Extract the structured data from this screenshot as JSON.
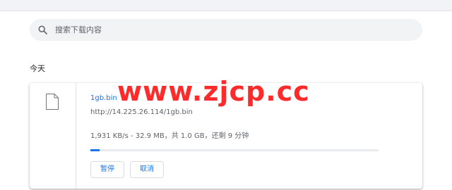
{
  "search": {
    "placeholder": "搜索下载内容"
  },
  "section": {
    "title": "今天"
  },
  "download": {
    "file_name": "1gb.bin",
    "url": "http://14.225.26.114/1gb.bin",
    "status": "1,931 KB/s - 32.9 MB，共 1.0 GB，还剩 9 分钟",
    "progress_fraction": 0.032,
    "pause_label": "暂停",
    "cancel_label": "取消",
    "file_icon": "file-icon"
  },
  "watermark": {
    "text": "www.zjcp.cc"
  },
  "colors": {
    "accent": "#1a73e8",
    "watermark": "#ff2a2a",
    "search_bg": "#f1f3f4"
  }
}
